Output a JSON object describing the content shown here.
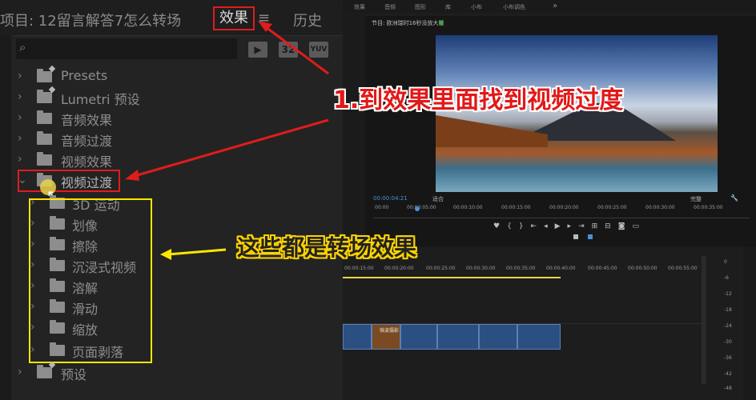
{
  "left_panel": {
    "tabs": {
      "project": "项目: 12留言解答7怎么转场",
      "effects": "效果",
      "menu": "≡",
      "history": "历史"
    },
    "toolbar": {
      "btn1": "▶",
      "btn2": "32",
      "btn3": "YUV"
    },
    "tree": [
      {
        "label": "Presets",
        "expanded": false
      },
      {
        "label": "Lumetri 预设",
        "expanded": false
      },
      {
        "label": "音频效果",
        "expanded": false
      },
      {
        "label": "音频过渡",
        "expanded": false
      },
      {
        "label": "视频效果",
        "expanded": false
      },
      {
        "label": "视频过渡",
        "expanded": true
      },
      {
        "label": "3D 运动",
        "child": true
      },
      {
        "label": "划像",
        "child": true
      },
      {
        "label": "擦除",
        "child": true
      },
      {
        "label": "沉浸式视频",
        "child": true
      },
      {
        "label": "溶解",
        "child": true
      },
      {
        "label": "滑动",
        "child": true
      },
      {
        "label": "缩放",
        "child": true
      },
      {
        "label": "页面剥落",
        "child": true
      },
      {
        "label": "预设",
        "expanded": false
      }
    ]
  },
  "top_menu": [
    "效果",
    "音频",
    "图形",
    "库",
    "小布",
    "小布调色",
    "»"
  ],
  "program_monitor": {
    "title": "节目: 欧洲瑞时16秒没放大版",
    "timecode": "00:00:04:21",
    "fit": "适合",
    "quality": "完整",
    "ruler": [
      "00:00",
      "00:00:05:00",
      "00:00:10:00",
      "00:00:15:00",
      "00:00:20:00",
      "00:00:25:00",
      "00:00:30:00",
      "00:00:35:00"
    ]
  },
  "timeline": {
    "ruler": [
      "00:00:15:00",
      "00:00:20:00",
      "00:00:25:00",
      "00:00:30:00",
      "00:00:35:00",
      "00:00:40:00",
      "00:00:45:00",
      "00:00:50:00",
      "00:00:55:00",
      "00:01:00:00"
    ],
    "clip_label": "微波摄影",
    "meter": [
      "0",
      "-6",
      "-12",
      "-18",
      "-24",
      "-30",
      "-36",
      "-42",
      "-48",
      "-54"
    ]
  },
  "annotations": {
    "step1": "1.到效果里面找到视频过度",
    "transitions_note": "这些都是转场效果"
  },
  "colors": {
    "red": "#e01c1c",
    "yellow": "#ffd400",
    "timecode_blue": "#4a90d9"
  }
}
